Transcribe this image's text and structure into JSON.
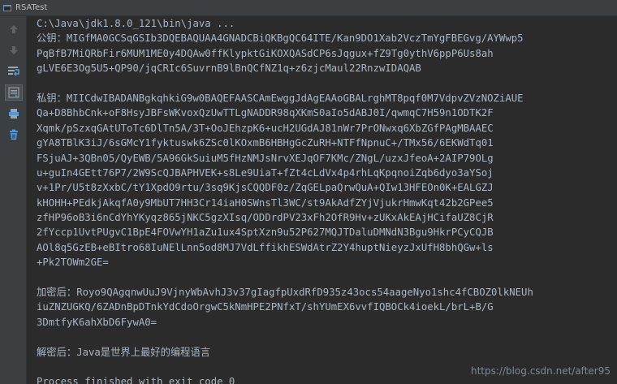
{
  "window": {
    "title": "RSATest"
  },
  "toolbar": {
    "tools": [
      {
        "name": "up-arrow-icon"
      },
      {
        "name": "down-arrow-icon"
      },
      {
        "name": "soft-wrap-icon"
      },
      {
        "name": "scroll-to-end-icon"
      },
      {
        "name": "print-icon"
      },
      {
        "name": "trash-icon"
      }
    ]
  },
  "console": {
    "command": "C:\\Java\\jdk1.8.0_121\\bin\\java ...",
    "public_key": [
      "公钥：MIGfMA0GCSqGSIb3DQEBAQUAA4GNADCBiQKBgQC64ITE/Kan9DO1Xab2VczTmYgFBEGvg/AYWwp5",
      "PqBfB7MiQRbFir6MUM1ME0y4DQAw0ffKlypktGiKOXQASdCP6sJqgux+fZ9Tg0ythV6ppP6Us8ah",
      "gLVE6E3Og5U5+QP90/jqCRIc6SuvrnB9lBnQCfNZ1q+z6zjcMaul22RnzwIDAQAB"
    ],
    "private_key": [
      "私钥：MIICdwIBADANBgkqhkiG9w0BAQEFAASCAmEwggJdAgEAAoGBALrghMT8pqf0M7VdpvZVzNOZiAUE",
      "Qa+D8BhbCnk+oF8HsyJBFsWKvoxQzUwTTLgNADDR98qXKmS0aIo5dABJ0I/qwmqC7H59n1ODTK2F",
      "Xqmk/pSzxqGAtUToTc6DlTn5A/3T+OoJEhzpK6+ucH2UGdAJ81nWr7PrONwxq6XbZGfPAgMBAAEC",
      "gYA8TBlK3iJ/6sGMcY1fyktuswk6ZSc0lKOxmB6HBHgGcZuRH+NTFfNpnuC+/TMx56/6EKWdTq01",
      "FSjuAJ+3QBn05/QyEWB/5A96GkSuiuM5fHzNMJsNrvXEJqOF7KMc/ZNgL/uzxJfeoA+2AIP79OLg",
      "u+guIn4GEtt76P7/2W9ScQJBAPHVEK+s8Le9UiaT+fZt4cLdVx4p4rhLqKpqnoiZqb6dyo3aYSoj",
      "v+1Pr/U5t8zXxbC/tY1XpdO9rtu/3sq9KjsCQQDF0z/ZqGELpaQrwQuA+QIw13HFEOn0K+EALGZJ",
      "kHOHH+PEdkjAkqfA0y9MbUT7HH3Cr14iaH0SWnsTl3WC/st9AkAdfZYjVjukrHmwKqt42b2GPee5",
      "zfHP96oB3i6nCdYhYKyqz865jNKC5gzXIsq/ODDrdPV23xFh2OfR9Hv+zUKxAkEAjHCifaUZ8CjR",
      "2fYccp1UvtPUgvC1BpE4FOVwYH1aZu1ux4SptXzn9u52P627MQJTDaluDMNdN3Bgu9HkrPCyCQJB",
      "AOl8q5GzEB+eBItro68IuNElLnn5od8MJ7VdLffikhESWdAtrZ2Y4huptNieyzJxUfH8bhQGw+ls",
      "+Pk2TOWm2GE="
    ],
    "encrypted": [
      "加密后：Royo9QAgqnwUuJ9VjnyWbAvhJ3v37gIagfpUxdRfD935z43ocs54aageNyo1shc4fCBOZ0lkNEUh",
      "iuZNZUGKQ/6ZADnBpDTnkYdCdoOrgwC5kNmHPE2PNfxT/shYUmEX6vvfIQBOCk4ioekL/brL+B/G",
      "3DmtfyK6ahXbD6FywA0="
    ],
    "decrypted": "解密后：Java是世界上最好的编程语言",
    "exit_message": "Process finished with exit code 0"
  },
  "watermark": "https://blog.csdn.net/after95",
  "colors": {
    "background": "#2b2b2b",
    "toolbar": "#3c3f41",
    "text": "#a9b7c6"
  }
}
